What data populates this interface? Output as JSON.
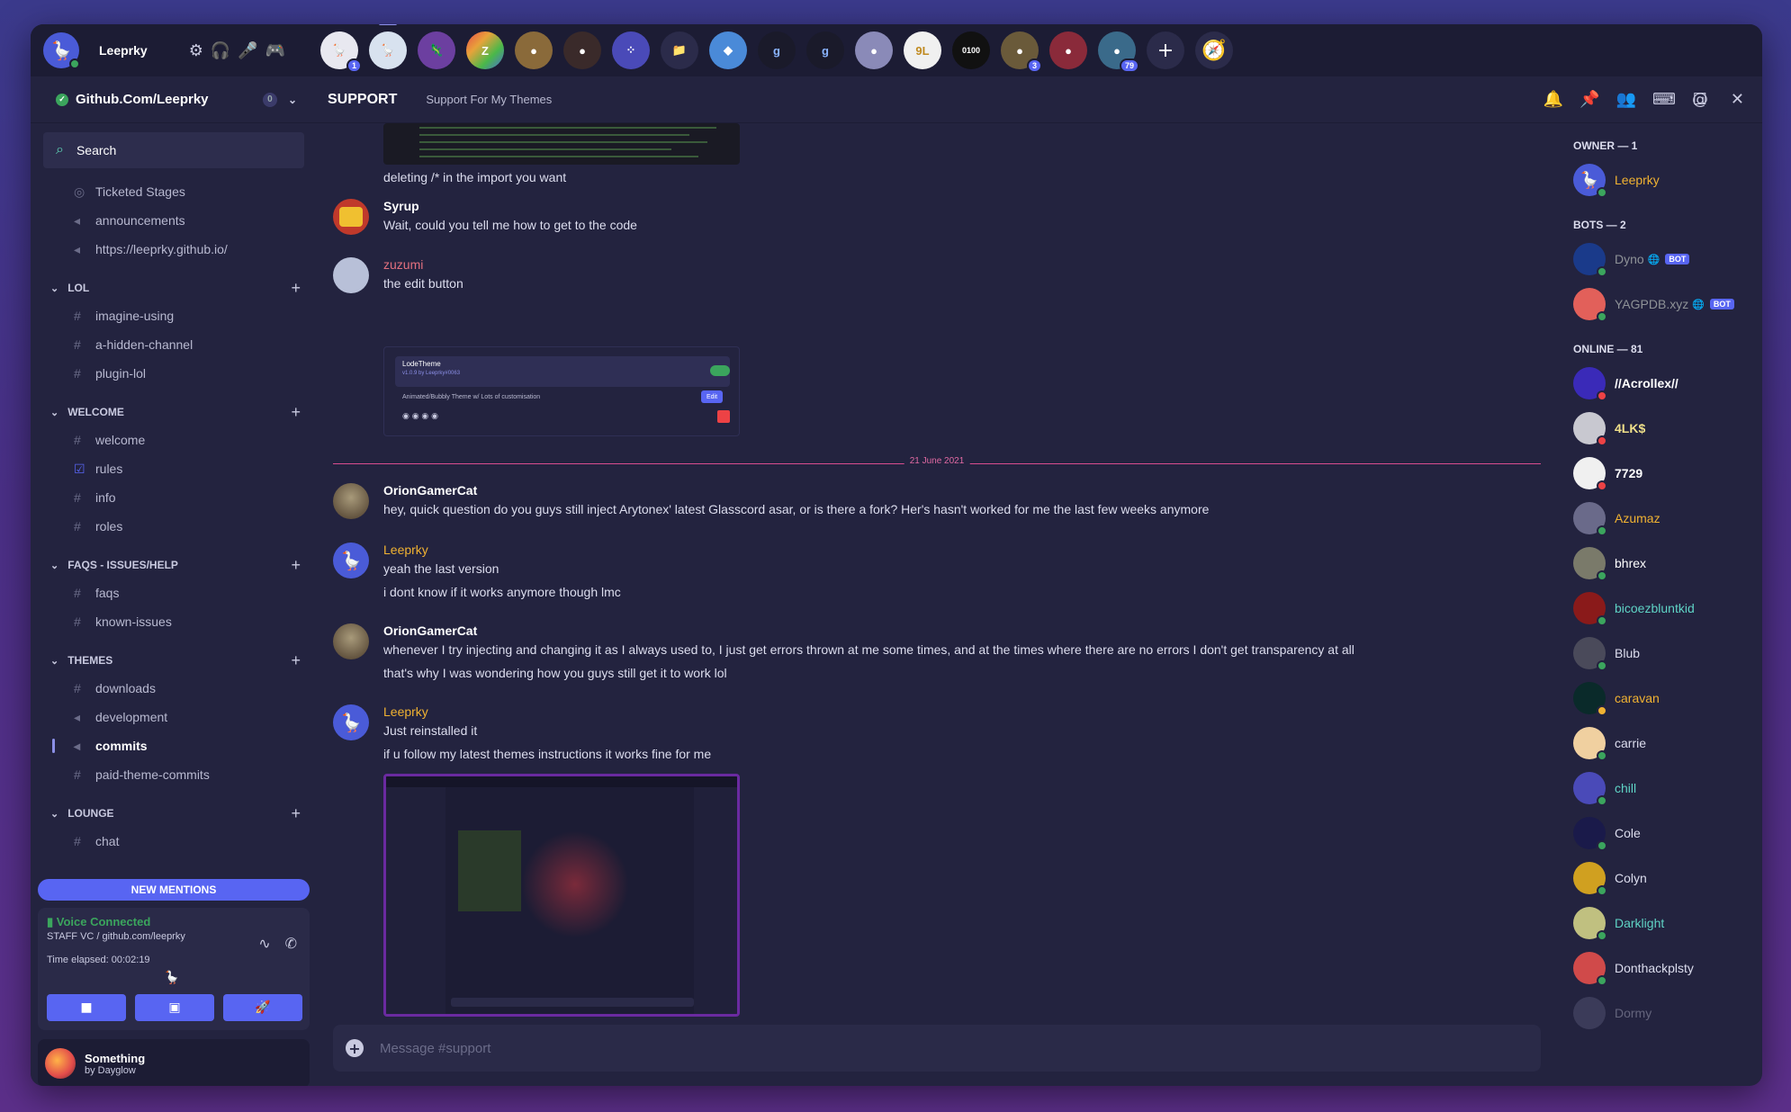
{
  "user": {
    "name": "Leeprky"
  },
  "servers": [
    {
      "badge": "1",
      "color": "#e8e8f0"
    },
    {
      "badge": "",
      "color": "#d8e2ef",
      "selected": true
    },
    {
      "badge": "",
      "color": "#6c3fa0"
    },
    {
      "badge": "",
      "color": "#e8a23a"
    },
    {
      "badge": "",
      "color": "#8a6a3a"
    },
    {
      "badge": "",
      "color": "#3a2a2a"
    },
    {
      "badge": "",
      "color": "#4a4ab8"
    },
    {
      "badge": "",
      "color": "#2b2b4a"
    },
    {
      "badge": "",
      "color": "#4a8ad8"
    },
    {
      "badge": "",
      "color": "#1a1a2a"
    },
    {
      "badge": "",
      "color": "#1a1a2a"
    },
    {
      "badge": "",
      "color": "#8a8ab8"
    },
    {
      "badge": "",
      "color": "#f0f0f0"
    },
    {
      "badge": "",
      "color": "#111111"
    },
    {
      "badge": "3",
      "color": "#6a5a3a"
    },
    {
      "badge": "",
      "color": "#8a2a3a"
    },
    {
      "badge": "79",
      "color": "#3a6a8a"
    }
  ],
  "header": {
    "guild": "Github.Com/Leeprky",
    "boost_count": "0",
    "channel": "SUPPORT",
    "topic": "Support For My Themes"
  },
  "sidebar": {
    "search_placeholder": "Search",
    "top_channels": [
      {
        "name": "Ticketed Stages",
        "icon": "stage-icon"
      },
      {
        "name": "announcements",
        "icon": "megaphone-icon"
      },
      {
        "name": "https://leeprky.github.io/",
        "icon": "megaphone-icon"
      }
    ],
    "categories": [
      {
        "name": "LOL",
        "channels": [
          {
            "name": "imagine-using",
            "icon": "hash-icon"
          },
          {
            "name": "a-hidden-channel",
            "icon": "hash-icon"
          },
          {
            "name": "plugin-lol",
            "icon": "hash-icon"
          }
        ]
      },
      {
        "name": "WELCOME",
        "channels": [
          {
            "name": "welcome",
            "icon": "hash-icon"
          },
          {
            "name": "rules",
            "icon": "checkbox-icon"
          },
          {
            "name": "info",
            "icon": "hash-icon"
          },
          {
            "name": "roles",
            "icon": "hash-icon"
          }
        ]
      },
      {
        "name": "FAQS - ISSUES/HELP",
        "channels": [
          {
            "name": "faqs",
            "icon": "hash-icon"
          },
          {
            "name": "known-issues",
            "icon": "hash-icon"
          }
        ]
      },
      {
        "name": "THEMES",
        "channels": [
          {
            "name": "downloads",
            "icon": "hash-icon"
          },
          {
            "name": "development",
            "icon": "megaphone-icon"
          },
          {
            "name": "commits",
            "icon": "megaphone-icon",
            "active": true
          },
          {
            "name": "paid-theme-commits",
            "icon": "hash-icon"
          }
        ]
      },
      {
        "name": "LOUNGE",
        "channels": [
          {
            "name": "chat",
            "icon": "hash-icon"
          }
        ]
      }
    ],
    "new_mentions": "NEW MENTIONS",
    "voice": {
      "status": "Voice Connected",
      "channel": "STAFF VC / github.com/leeprky",
      "elapsed": "Time elapsed: 00:02:19"
    },
    "now_playing": {
      "title": "Something",
      "artist": "by Dayglow"
    }
  },
  "chat": {
    "messages": [
      {
        "text": "deleting /* in the import you want"
      },
      {
        "author": "Syrup",
        "color": "#ffffff",
        "lines": [
          "Wait, could you tell me how to get to the code"
        ]
      },
      {
        "author": "zuzumi",
        "color": "#e2707e",
        "lines": [
          "the edit button"
        ]
      },
      {
        "author": "OrionGamerCat",
        "color": "#ffffff",
        "lines": [
          "hey, quick question do you guys still inject Arytonex' latest Glasscord asar, or is there a fork? Her's hasn't worked for me the last few weeks anymore"
        ]
      },
      {
        "author": "Leeprky",
        "color": "#f0b232",
        "lines": [
          "yeah the last version",
          "i dont know if it works anymore though lmc"
        ]
      },
      {
        "author": "OrionGamerCat",
        "color": "#ffffff",
        "lines": [
          "whenever I try injecting and changing it as I always used to, I just get errors thrown at me some times, and at the times where there are no errors I don't get transparency at all",
          "that's why I was wondering how you guys still get it to work lol"
        ]
      },
      {
        "author": "Leeprky",
        "color": "#f0b232",
        "lines": [
          "Just reinstalled it",
          "if u follow my latest themes instructions it works fine for me"
        ]
      }
    ],
    "date_divider": "21 June 2021",
    "embed": {
      "title": "LodeTheme",
      "version": "v1.0.9 by Leeprky#0063",
      "desc": "Animated/Bubbly Theme w/ Lots of customisation",
      "edit_label": "Edit"
    },
    "composer_placeholder": "Message #support"
  },
  "members": {
    "groups": [
      {
        "title": "OWNER — 1",
        "members": [
          {
            "name": "Leeprky",
            "color": "#f0b232",
            "status": "#3ba55d"
          }
        ]
      },
      {
        "title": "BOTS — 2",
        "members": [
          {
            "name": "Dyno",
            "color": "#8e9297",
            "bot": "BOT",
            "status": "#3ba55d"
          },
          {
            "name": "YAGPDB.xyz",
            "color": "#8e9297",
            "bot": "BOT",
            "status": "#3ba55d"
          }
        ]
      },
      {
        "title": "ONLINE — 81",
        "members": [
          {
            "name": "//Acrollex//",
            "color": "#ffffff",
            "status": "#ed4245"
          },
          {
            "name": "4LK$",
            "color": "#f0e08a",
            "status": "#ed4245"
          },
          {
            "name": "7729",
            "color": "#ffffff",
            "status": "#ed4245"
          },
          {
            "name": "Azumaz",
            "color": "#f0b232",
            "status": "#3ba55d"
          },
          {
            "name": "bhrex",
            "color": "#ffffff",
            "status": "#3ba55d"
          },
          {
            "name": "bicoezbluntkid",
            "color": "#5fd3c5",
            "status": "#3ba55d"
          },
          {
            "name": "Blub",
            "color": "#dcddee",
            "status": "#3ba55d"
          },
          {
            "name": "caravan",
            "color": "#f0b232",
            "status": "#f0b232"
          },
          {
            "name": "carrie",
            "color": "#dcddee",
            "status": "#3ba55d"
          },
          {
            "name": "chill",
            "color": "#5fd3c5",
            "status": "#3ba55d"
          },
          {
            "name": "Cole",
            "color": "#dcddee",
            "status": "#3ba55d"
          },
          {
            "name": "Colyn",
            "color": "#dcddee",
            "status": "#3ba55d"
          },
          {
            "name": "Darklight",
            "color": "#5fd3c5",
            "status": "#3ba55d"
          },
          {
            "name": "Donthackplsty",
            "color": "#dcddee",
            "status": "#3ba55d"
          },
          {
            "name": "Dormy",
            "color": "#6b6c89",
            "status": "#3ba55d"
          }
        ]
      }
    ]
  }
}
